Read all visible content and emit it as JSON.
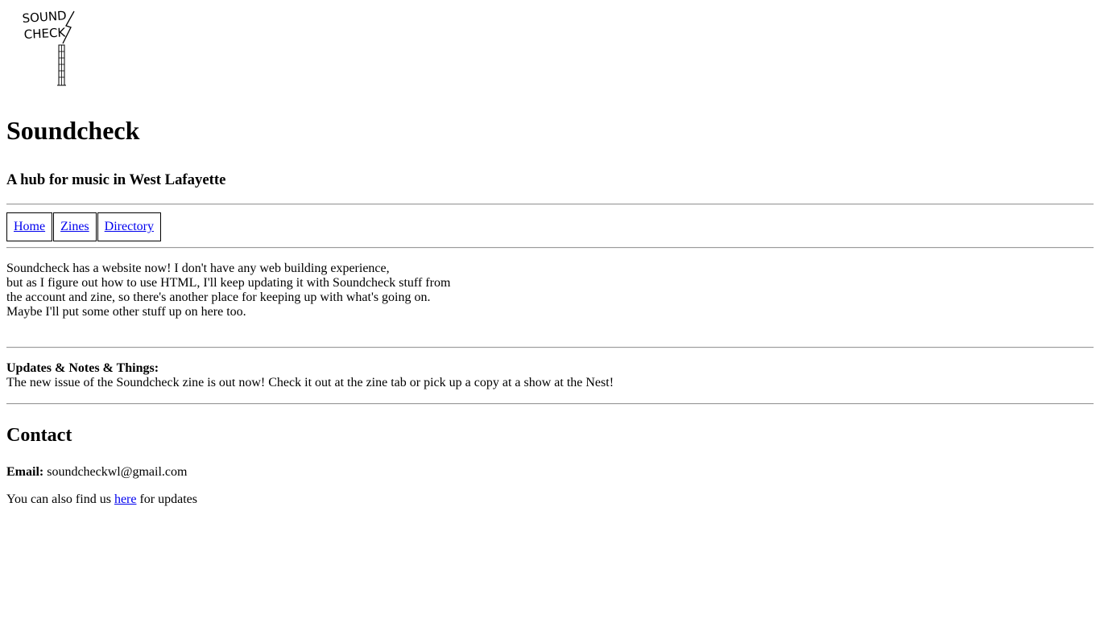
{
  "logo": {
    "word1": "SOUND",
    "word2": "CHECK"
  },
  "header": {
    "title": "Soundcheck",
    "subtitle": "A hub for music in West Lafayette"
  },
  "nav": {
    "items": [
      {
        "label": "Home"
      },
      {
        "label": "Zines"
      },
      {
        "label": "Directory"
      }
    ]
  },
  "intro": {
    "lines": [
      "Soundcheck has a website now! I don't have any web building experience,",
      "but as I figure out how to use HTML, I'll keep updating it with Soundcheck stuff from",
      "the account and zine, so there's another place for keeping up with what's going on.",
      "Maybe I'll put some other stuff up on here too."
    ]
  },
  "updates": {
    "heading": "Updates & Notes & Things:",
    "text": "The new issue of the Soundcheck zine is out now! Check it out at the zine tab or pick up a copy at a show at the Nest!"
  },
  "contact": {
    "heading": "Contact",
    "email_label": "Email:",
    "email_value": "soundcheckwl@gmail.com",
    "find_prefix": "You can also find us",
    "find_link": "here",
    "find_suffix": "for updates"
  }
}
